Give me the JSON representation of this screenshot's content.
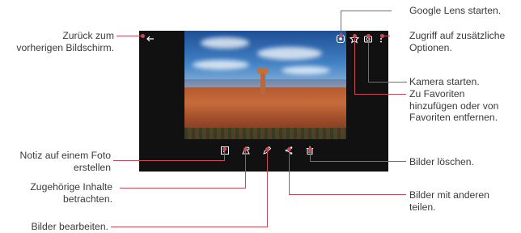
{
  "callouts": {
    "back": [
      "Zurück zum",
      "vorherigen Bildschirm."
    ],
    "google_lens": "Google Lens starten.",
    "more_options": [
      "Zugriff auf zusätzliche",
      "Optionen."
    ],
    "camera": "Kamera starten.",
    "favorites": [
      "Zu Favoriten",
      "hinzufügen oder von",
      "Favoriten entfernen."
    ],
    "note": [
      "Notiz auf einem Foto",
      "erstellen"
    ],
    "related": [
      "Zugehörige Inhalte",
      "betrachten."
    ],
    "edit": "Bilder bearbeiten.",
    "delete": "Bilder löschen.",
    "share": [
      "Bilder mit anderen",
      "teilen."
    ]
  },
  "icons": {
    "back": "back-arrow-icon",
    "lens": "google-lens-icon",
    "favorite": "star-icon",
    "camera": "camera-icon",
    "more": "more-vertical-icon",
    "note": "note-icon",
    "related": "related-content-icon",
    "edit": "edit-pencil-icon",
    "share": "share-icon",
    "delete": "trash-icon"
  },
  "colors": {
    "callout_line": "#c44a57"
  }
}
